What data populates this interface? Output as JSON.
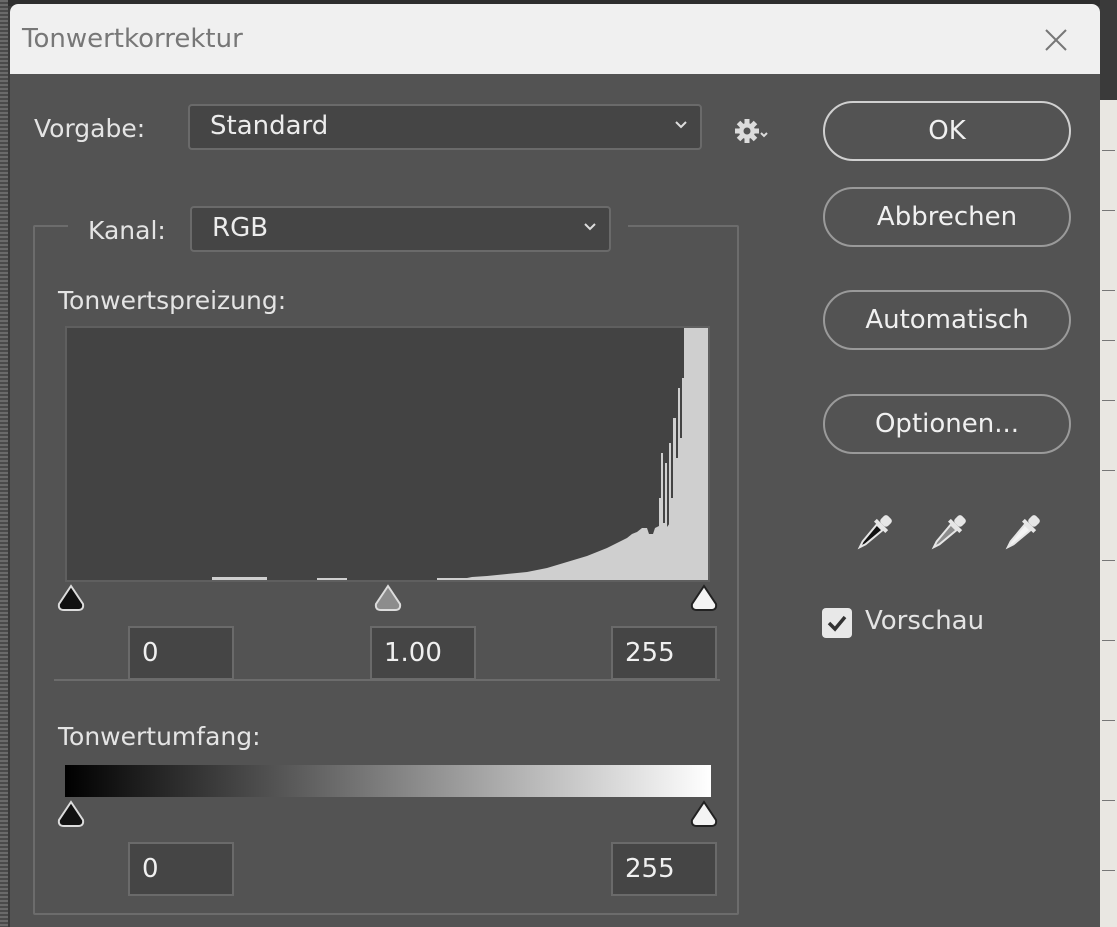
{
  "dialog": {
    "title": "Tonwertkorrektur"
  },
  "preset": {
    "label": "Vorgabe:",
    "value": "Standard"
  },
  "channel": {
    "label": "Kanal:",
    "value": "RGB"
  },
  "input_levels": {
    "label": "Tonwertspreizung:",
    "black": "0",
    "gamma": "1.00",
    "white": "255"
  },
  "output_levels": {
    "label": "Tonwertumfang:",
    "black": "0",
    "white": "255"
  },
  "buttons": {
    "ok": "OK",
    "cancel": "Abbrechen",
    "auto": "Automatisch",
    "options": "Optionen..."
  },
  "preview": {
    "label": "Vorschau",
    "checked": true
  },
  "icons": {
    "close": "close-icon",
    "gear": "gear-icon",
    "chevron": "chevron-down-icon",
    "eyedroppers": [
      "black-eyedropper-icon",
      "gray-eyedropper-icon",
      "white-eyedropper-icon"
    ]
  },
  "colors": {
    "dialog_bg": "#535353",
    "titlebar_bg": "#f0f0f0",
    "histogram_fill": "#cfcfcf"
  }
}
